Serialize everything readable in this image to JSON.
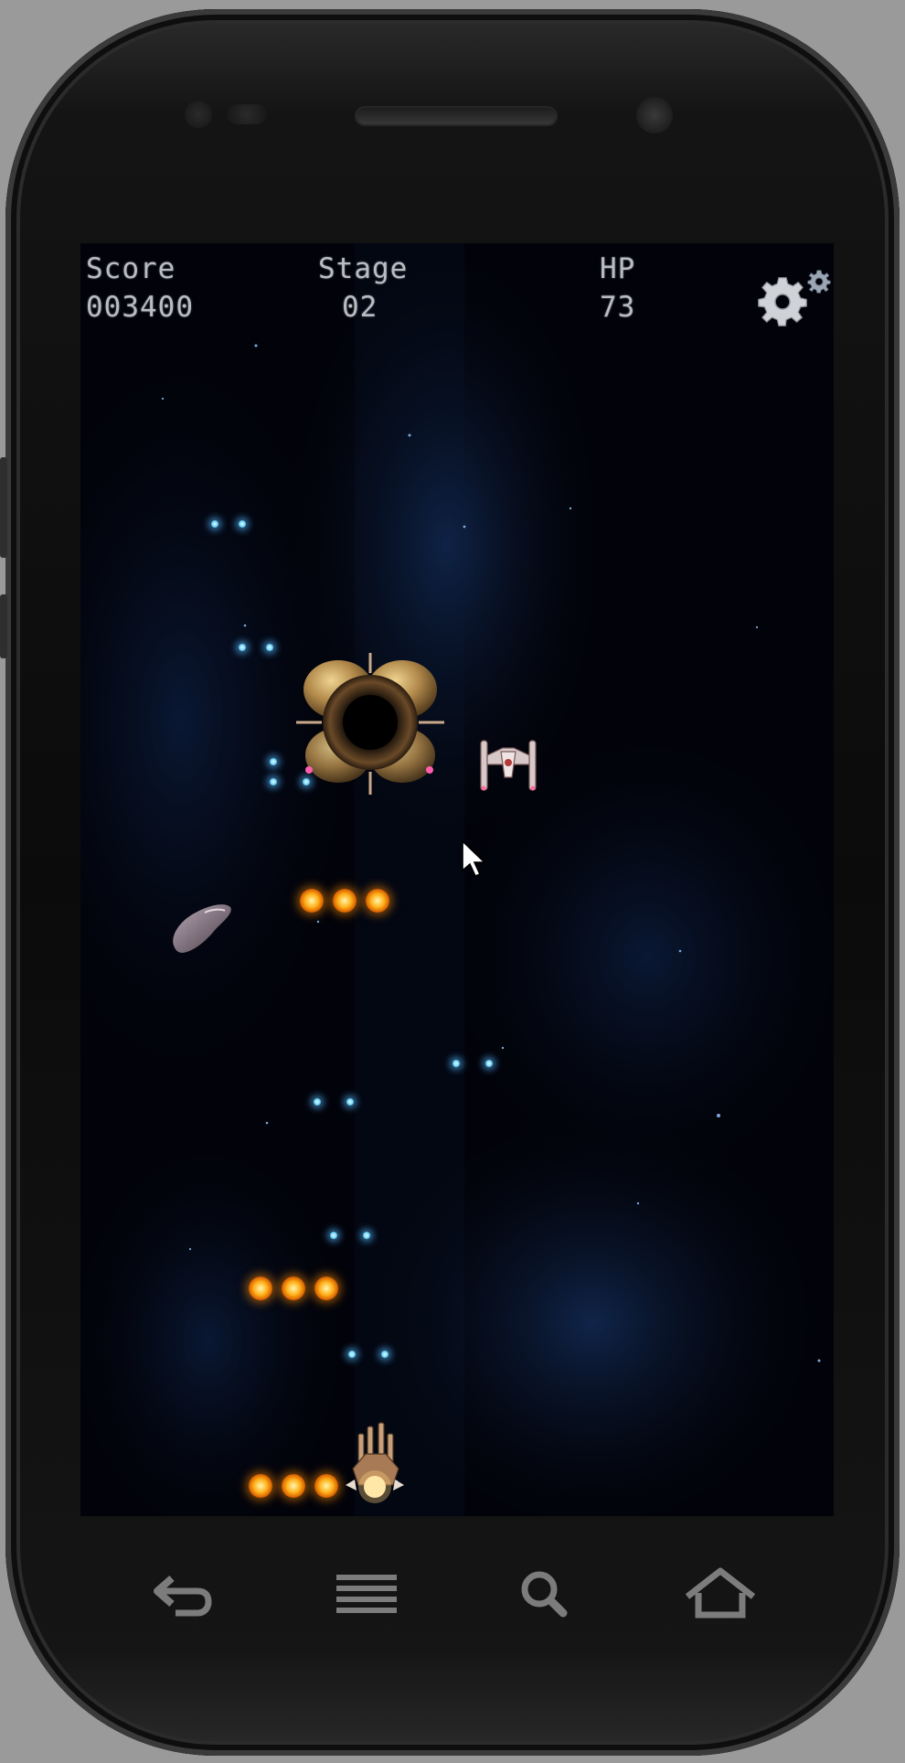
{
  "hud": {
    "score_label": "Score",
    "score_value": "003400",
    "stage_label": "Stage",
    "stage_value": "02",
    "hp_label": "HP",
    "hp_value": "73"
  },
  "icons": {
    "settings": "gear-icon",
    "nav": [
      "back-icon",
      "menu-icon",
      "search-icon",
      "home-icon"
    ],
    "cursor": "mouse-pointer-icon"
  },
  "colors": {
    "space": "#02030a",
    "nebula": "#0d1f45",
    "enemy_bullet": "#6ad4ff",
    "player_fire": "#ffb019",
    "hud_text": "#b8bcc4"
  }
}
